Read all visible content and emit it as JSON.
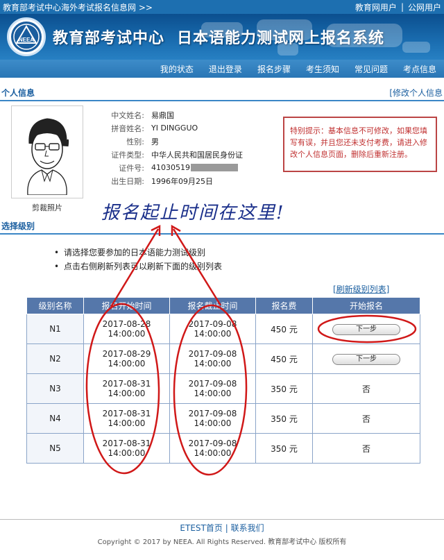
{
  "topbar": {
    "title": "教育部考试中心海外考试报名信息网 >>",
    "links": [
      "教育网用户",
      "|",
      "公网用户"
    ]
  },
  "banner": {
    "org": "教育部考试中心",
    "system": "日本语能力测试网上报名系统",
    "logo_text": "NEEA"
  },
  "nav": [
    "我的状态",
    "退出登录",
    "报名步骤",
    "考生须知",
    "常见问题",
    "考点信息"
  ],
  "personal": {
    "section_title": "个人信息",
    "edit_link": "[修改个人信息",
    "photo_caption": "剪裁照片",
    "fields": [
      {
        "label": "中文姓名:",
        "value": "易鼎国"
      },
      {
        "label": "拼音姓名:",
        "value": "YI DINGGUO"
      },
      {
        "label": "性别:",
        "value": "男"
      },
      {
        "label": "证件类型:",
        "value": "中华人民共和国居民身份证"
      },
      {
        "label": "证件号:",
        "value": "41030519"
      },
      {
        "label": "出生日期:",
        "value": "1996年09月25日"
      }
    ],
    "notice": "特别提示：基本信息不可修改，如果您填写有误，并且您还未支付考费，请进入修改个人信息页面，删除后重新注册。"
  },
  "level": {
    "section_title": "选择级别",
    "bullets": [
      "请选择您要参加的日本语能力测试级别",
      "点击右侧刷新列表可以刷新下面的级别列表"
    ],
    "refresh_link": "[刷新级别列表]",
    "headers": [
      "级别名称",
      "报名开始时间",
      "报名截止时间",
      "报名费",
      "开始报名"
    ],
    "rows": [
      {
        "level": "N1",
        "start_date": "2017-08-28",
        "start_time": "14:00:00",
        "end_date": "2017-09-08",
        "end_time": "14:00:00",
        "fee": "450 元",
        "action": "下一步",
        "button": true
      },
      {
        "level": "N2",
        "start_date": "2017-08-29",
        "start_time": "14:00:00",
        "end_date": "2017-09-08",
        "end_time": "14:00:00",
        "fee": "450 元",
        "action": "下一步",
        "button": true
      },
      {
        "level": "N3",
        "start_date": "2017-08-31",
        "start_time": "14:00:00",
        "end_date": "2017-09-08",
        "end_time": "14:00:00",
        "fee": "350 元",
        "action": "否",
        "button": false
      },
      {
        "level": "N4",
        "start_date": "2017-08-31",
        "start_time": "14:00:00",
        "end_date": "2017-09-08",
        "end_time": "14:00:00",
        "fee": "350 元",
        "action": "否",
        "button": false
      },
      {
        "level": "N5",
        "start_date": "2017-08-31",
        "start_time": "14:00:00",
        "end_date": "2017-09-08",
        "end_time": "14:00:00",
        "fee": "350 元",
        "action": "否",
        "button": false
      }
    ]
  },
  "annotation": {
    "text": "报名起止时间在这里!",
    "color": "#d01818"
  },
  "footer": {
    "links": [
      "ETEST首页",
      "|",
      "联系我们"
    ],
    "copyright": "Copyright © 2017 by NEEA. All Rights Reserved. 教育部考试中心 版权所有"
  }
}
